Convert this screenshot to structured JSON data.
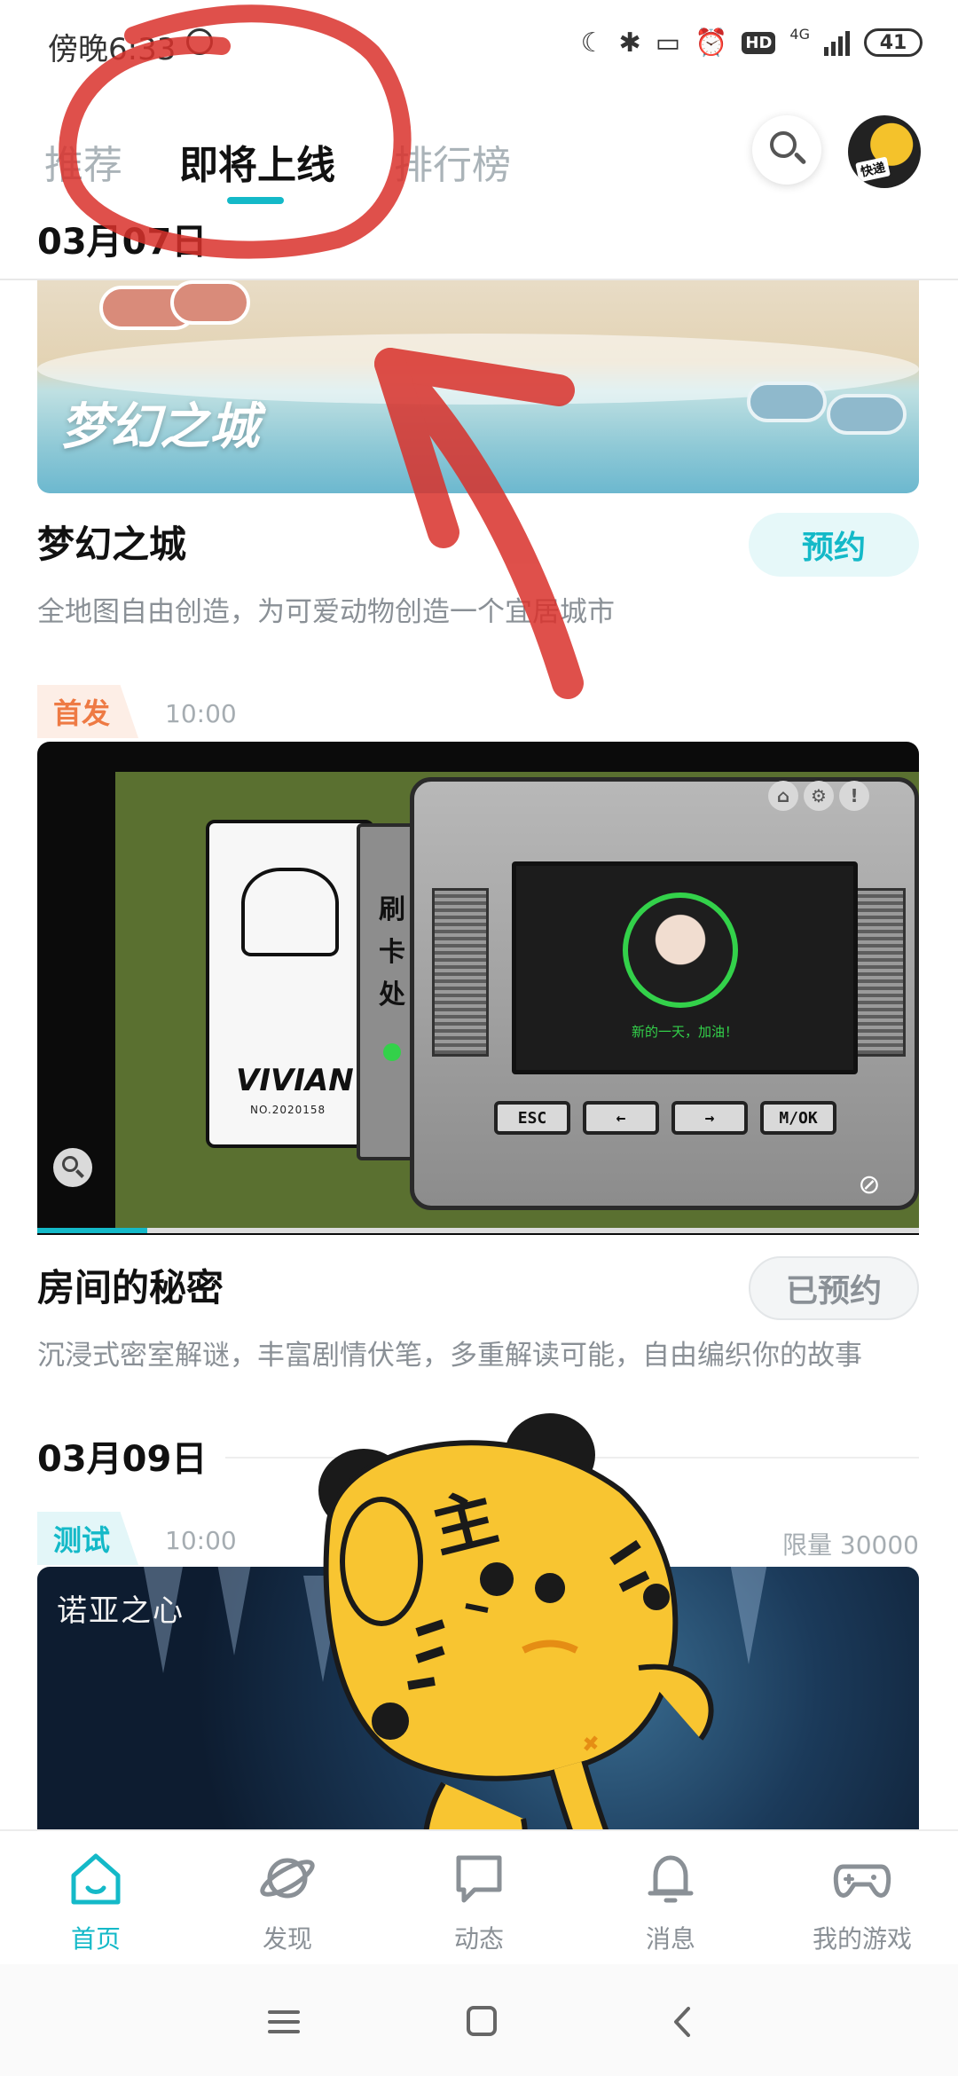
{
  "status_bar": {
    "time": "傍晚6:33",
    "network": "4G",
    "hd": "HD",
    "battery": "41"
  },
  "top_nav": {
    "tabs": [
      {
        "label": "推荐",
        "active": false
      },
      {
        "label": "即将上线",
        "active": true
      },
      {
        "label": "排行榜",
        "active": false
      }
    ],
    "search_icon": "search-icon",
    "avatar_label": "快递"
  },
  "sections": {
    "date_1": "03月07日",
    "date_2": "03月09日"
  },
  "games": [
    {
      "banner_logo": "梦幻之城",
      "title": "梦幻之城",
      "description": "全地图自由创造，为可爱动物创造一个宜居城市",
      "button_label": "预约",
      "reserved": false
    },
    {
      "tag": "首发",
      "time": "10:00",
      "banner_card_signature": "VIVIAN",
      "banner_card_number": "NO.2020158",
      "banner_slot_text": "刷卡处",
      "banner_screen_text": "新的一天，加油！",
      "banner_keys": [
        "ESC",
        "←",
        "→",
        "M/OK"
      ],
      "video_progress": 0.125,
      "title": "房间的秘密",
      "description": "沉浸式密室解谜，丰富剧情伏笔，多重解读可能，自由编织你的故事",
      "button_label": "已预约",
      "reserved": true
    },
    {
      "tag": "测试",
      "time": "10:00",
      "limit": "限量 30000",
      "banner_logo": "诺亚之心"
    }
  ],
  "bottom_nav": {
    "items": [
      {
        "label": "首页",
        "icon": "home-icon",
        "active": true
      },
      {
        "label": "发现",
        "icon": "planet-icon",
        "active": false
      },
      {
        "label": "动态",
        "icon": "chat-icon",
        "active": false
      },
      {
        "label": "消息",
        "icon": "bell-icon",
        "active": false
      },
      {
        "label": "我的游戏",
        "icon": "gamepad-icon",
        "active": false
      }
    ]
  },
  "sticker": {
    "character": "主"
  },
  "colors": {
    "accent": "#14b9c8",
    "first_release_tag": "#ee7a44",
    "annotation_red": "#d9312b",
    "sticker_yellow": "#f8c531"
  }
}
